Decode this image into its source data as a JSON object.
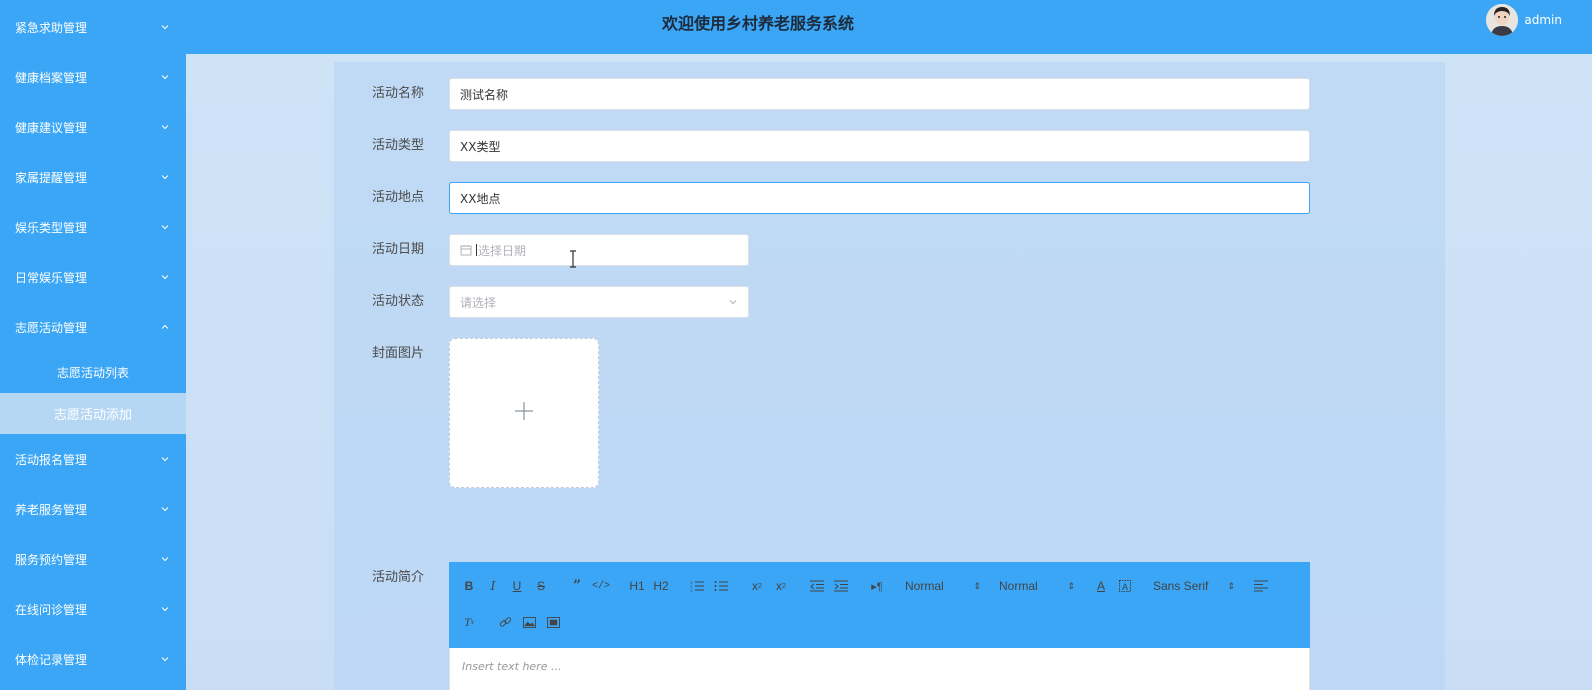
{
  "header": {
    "title": "欢迎使用乡村养老服务系统",
    "user_name": "admin"
  },
  "sidebar": {
    "items": [
      {
        "label": "紧急求助管理",
        "expanded": false
      },
      {
        "label": "健康档案管理",
        "expanded": false
      },
      {
        "label": "健康建议管理",
        "expanded": false
      },
      {
        "label": "家属提醒管理",
        "expanded": false
      },
      {
        "label": "娱乐类型管理",
        "expanded": false
      },
      {
        "label": "日常娱乐管理",
        "expanded": false
      },
      {
        "label": "志愿活动管理",
        "expanded": true
      },
      {
        "label": "活动报名管理",
        "expanded": false
      },
      {
        "label": "养老服务管理",
        "expanded": false
      },
      {
        "label": "服务预约管理",
        "expanded": false
      },
      {
        "label": "在线问诊管理",
        "expanded": false
      },
      {
        "label": "体检记录管理",
        "expanded": false
      }
    ],
    "sub_items": [
      {
        "label": "志愿活动列表",
        "active": false
      },
      {
        "label": "志愿活动添加",
        "active": true
      }
    ]
  },
  "form": {
    "name": {
      "label": "活动名称",
      "value": "测试名称"
    },
    "type": {
      "label": "活动类型",
      "value": "XX类型"
    },
    "location": {
      "label": "活动地点",
      "value": "XX地点"
    },
    "date": {
      "label": "活动日期",
      "placeholder": "选择日期"
    },
    "status": {
      "label": "活动状态",
      "placeholder": "请选择"
    },
    "cover": {
      "label": "封面图片"
    },
    "intro": {
      "label": "活动简介",
      "editor_placeholder": "Insert text here ..."
    }
  },
  "editor_toolbar": {
    "header_picker": "Normal",
    "size_picker": "Normal",
    "font_picker": "Sans Serif",
    "h1": "H1",
    "h2": "H2"
  },
  "colors": {
    "accent": "#3aa6f5",
    "sub_active": "#b6d7f3"
  }
}
